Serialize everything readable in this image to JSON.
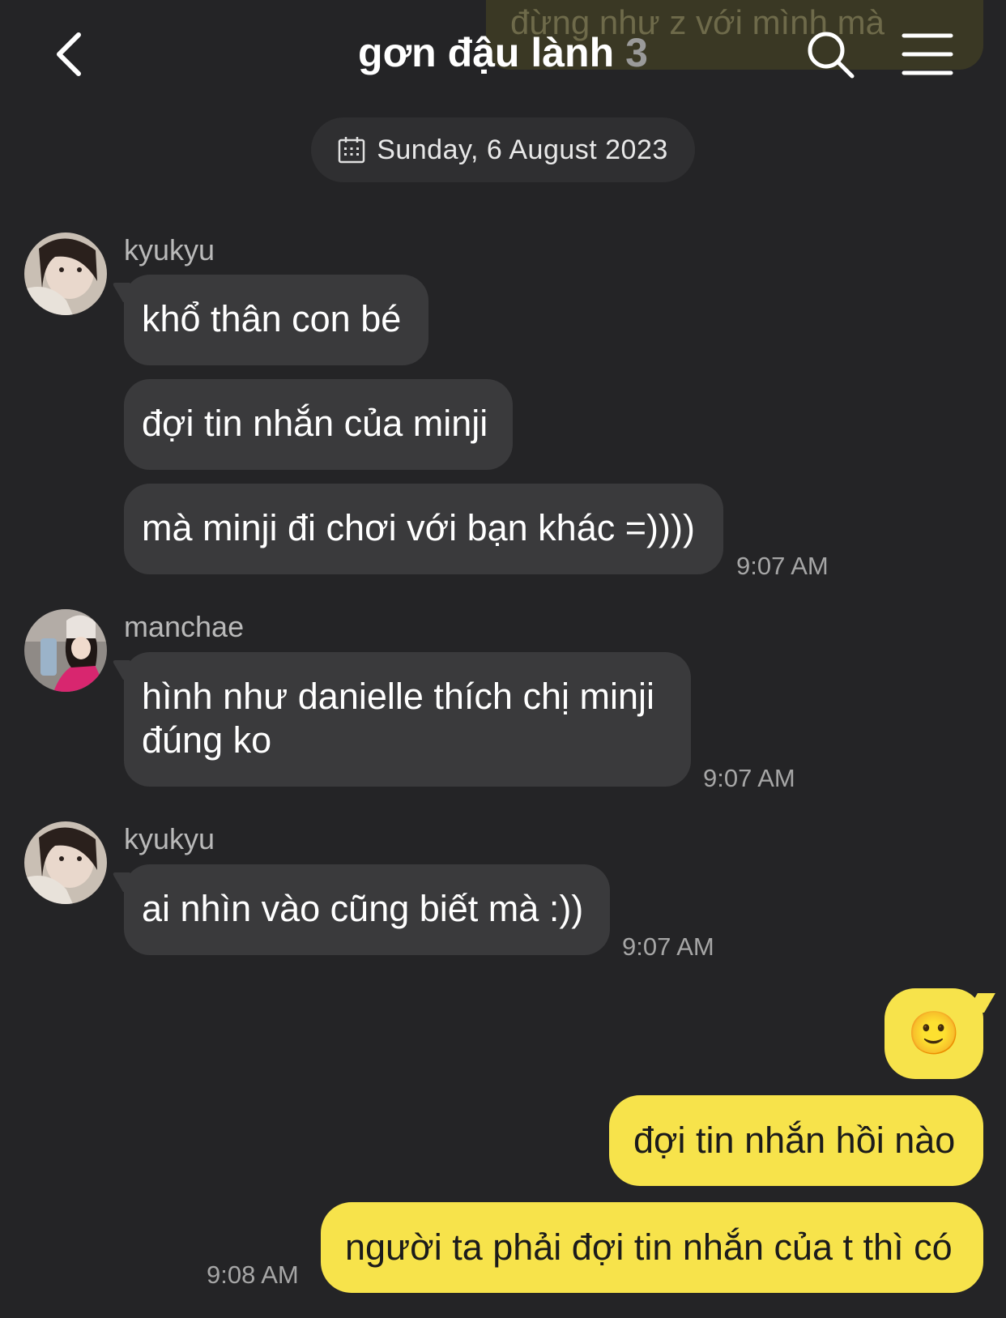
{
  "peek_message": "đừng như z với mình mà",
  "header": {
    "title": "gơn đậu lành",
    "member_count": "3"
  },
  "date_divider": "Sunday, 6 August 2023",
  "messages": [
    {
      "sender": "kyukyu",
      "lines": [
        "khổ thân con bé",
        "đợi tin nhắn của minji",
        "mà minji đi chơi với bạn khác =))))"
      ],
      "time": "9:07 AM"
    },
    {
      "sender": "manchae",
      "lines": [
        "hình như danielle thích chị minji đúng ko"
      ],
      "time": "9:07 AM"
    },
    {
      "sender": "kyukyu",
      "lines": [
        "ai nhìn vào cũng biết mà :))"
      ],
      "time": "9:07 AM"
    }
  ],
  "my_messages": {
    "emoji": "🙂",
    "lines": [
      "đợi tin nhắn hồi nào",
      "người ta phải đợi tin nhắn của t thì có"
    ],
    "time": "9:08 AM"
  },
  "colors": {
    "background": "#242426",
    "incoming_bubble": "#3a3a3c",
    "outgoing_bubble": "#f7e34b"
  }
}
